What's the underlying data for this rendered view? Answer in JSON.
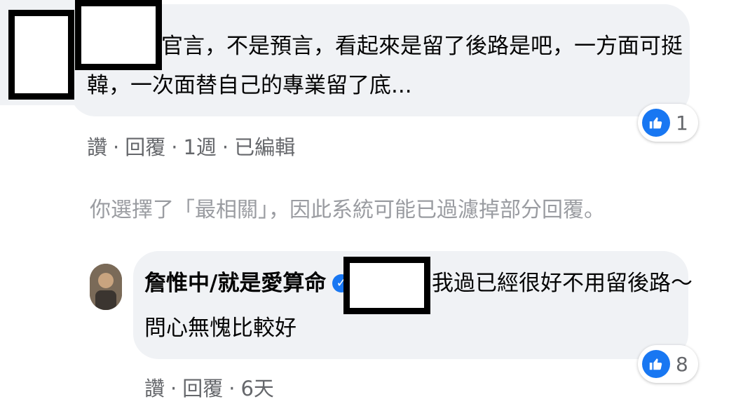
{
  "comment1": {
    "text_line1": "官言，不是預言，看起來是留了後路是吧，一方面可挺",
    "text_line2": "韓，一次面替自己的專業留了底...",
    "reaction_count": "1",
    "actions": {
      "like": "讚",
      "reply": "回覆",
      "time": "1週",
      "edited": "已編輯"
    }
  },
  "filter_note": "你選擇了「最相關」，因此系統可能已過濾掉部分回覆。",
  "comment2": {
    "author": "詹惟中/就是愛算命",
    "text_line1": "我過已經很好不用留後路～",
    "text_line2": "問心無愧比較好",
    "reaction_count": "8",
    "actions": {
      "like": "讚",
      "reply": "回覆",
      "time": "6天"
    }
  },
  "colors": {
    "bubble": "#f0f2f5",
    "like_blue": "#1877f2",
    "meta_gray": "#65676b"
  },
  "icons": {
    "reaction": "like-thumb-icon",
    "verified": "verified-badge-icon"
  }
}
